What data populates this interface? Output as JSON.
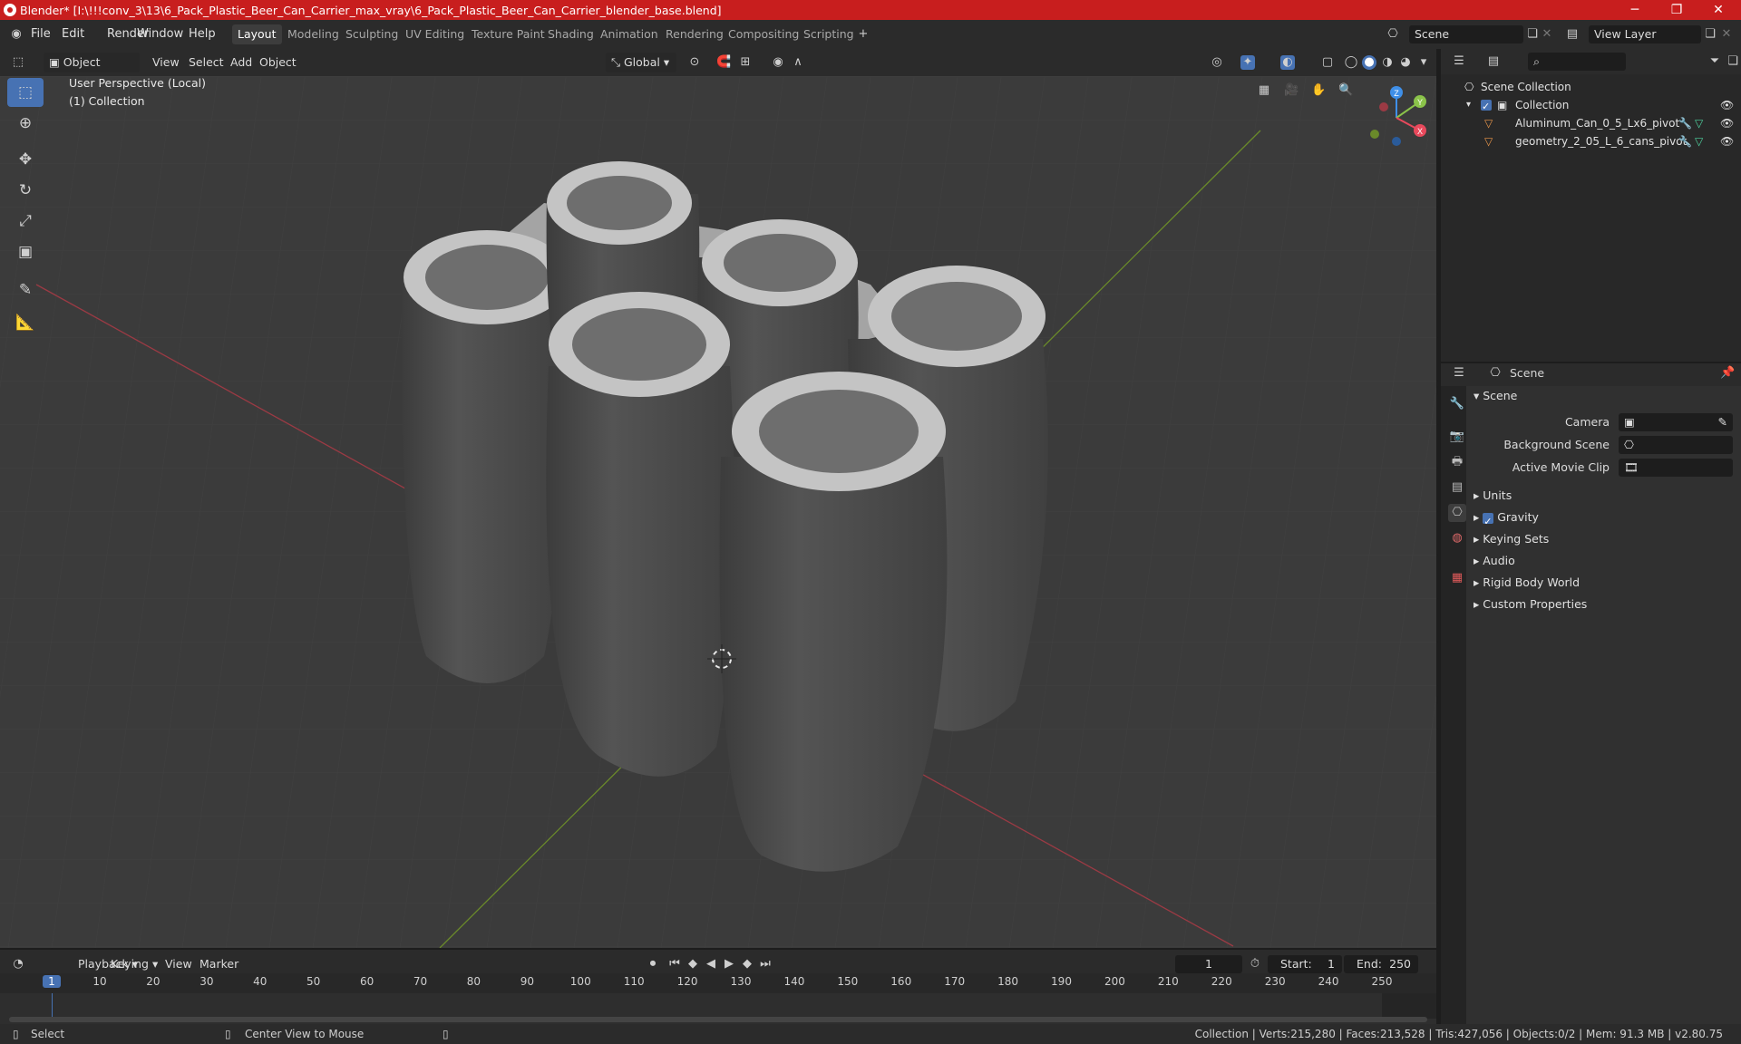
{
  "title": "Blender* [I:\\!!!conv_3\\13\\6_Pack_Plastic_Beer_Can_Carrier_max_vray\\6_Pack_Plastic_Beer_Can_Carrier_blender_base.blend]",
  "menus": [
    "File",
    "Edit",
    "Render",
    "Window",
    "Help"
  ],
  "workspaces": [
    "Layout",
    "Modeling",
    "Sculpting",
    "UV Editing",
    "Texture Paint",
    "Shading",
    "Animation",
    "Rendering",
    "Compositing",
    "Scripting"
  ],
  "scene_field": "Scene",
  "view_layer_field": "View Layer",
  "viewport_header": {
    "mode": "Object Mode",
    "view": "View",
    "select": "Select",
    "add": "Add",
    "object": "Object",
    "orientation": "Global"
  },
  "viewport": {
    "perspective": "User Perspective (Local)",
    "collection": "(1) Collection"
  },
  "gizmo": {
    "x": "X",
    "y": "Y",
    "z": "Z"
  },
  "outliner": {
    "root": "Scene Collection",
    "collection": "Collection",
    "items": [
      "Aluminum_Can_0_5_Lx6_pivot",
      "geometry_2_05_L_6_cans_pivot"
    ]
  },
  "properties": {
    "header": "Scene",
    "panel": "Scene",
    "camera_label": "Camera",
    "background_scene_label": "Background Scene",
    "active_movie_clip_label": "Active Movie Clip",
    "subpanels": [
      "Units",
      "Gravity",
      "Keying Sets",
      "Audio",
      "Rigid Body World",
      "Custom Properties"
    ]
  },
  "timeline": {
    "playback": "Playback",
    "keying": "Keying",
    "view": "View",
    "marker": "Marker",
    "current_frame": "1",
    "start_label": "Start:",
    "start": "1",
    "end_label": "End:",
    "end": "250",
    "ticks": [
      "1",
      "10",
      "20",
      "30",
      "40",
      "50",
      "60",
      "70",
      "80",
      "90",
      "100",
      "110",
      "120",
      "130",
      "140",
      "150",
      "160",
      "170",
      "180",
      "190",
      "200",
      "210",
      "220",
      "230",
      "240",
      "250"
    ]
  },
  "status": {
    "select": "Select",
    "center": "Center View to Mouse",
    "stats": "Collection | Verts:215,280 | Faces:213,528 | Tris:427,056 | Objects:0/2 | Mem: 91.3 MB | v2.80.75"
  },
  "colors": {
    "title_bar": "#c81e1e",
    "accent": "#4772b3",
    "x_axis": "#e8495c",
    "y_axis": "#8bc34a",
    "z_axis": "#3f8fe8"
  }
}
